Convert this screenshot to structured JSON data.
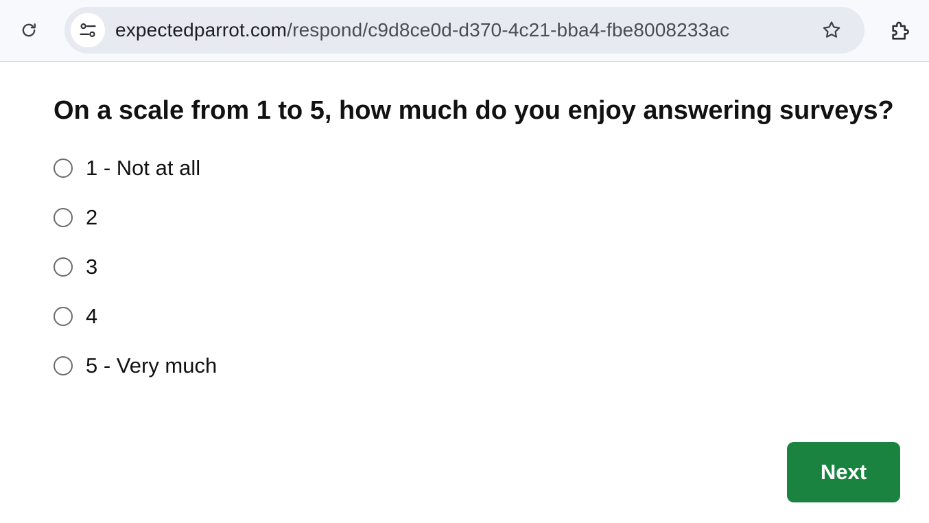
{
  "browser": {
    "url_host": "expectedparrot.com",
    "url_path": "/respond/c9d8ce0d-d370-4c21-bba4-fbe8008233ac",
    "icons": {
      "reload": "reload-icon",
      "site_info": "site-settings-icon",
      "bookmark": "star-icon",
      "extensions": "puzzle-piece-icon"
    }
  },
  "survey": {
    "question": "On a scale from 1 to 5, how much do you enjoy answering surveys?",
    "options": [
      {
        "label": "1 - Not at all",
        "selected": false
      },
      {
        "label": "2",
        "selected": false
      },
      {
        "label": "3",
        "selected": false
      },
      {
        "label": "4",
        "selected": false
      },
      {
        "label": "5 - Very much",
        "selected": false
      }
    ],
    "next_label": "Next"
  },
  "colors": {
    "next_button": "#1a8340",
    "toolbar_bg": "#f8f9fc",
    "omnibox_bg": "#e8eaf2"
  }
}
